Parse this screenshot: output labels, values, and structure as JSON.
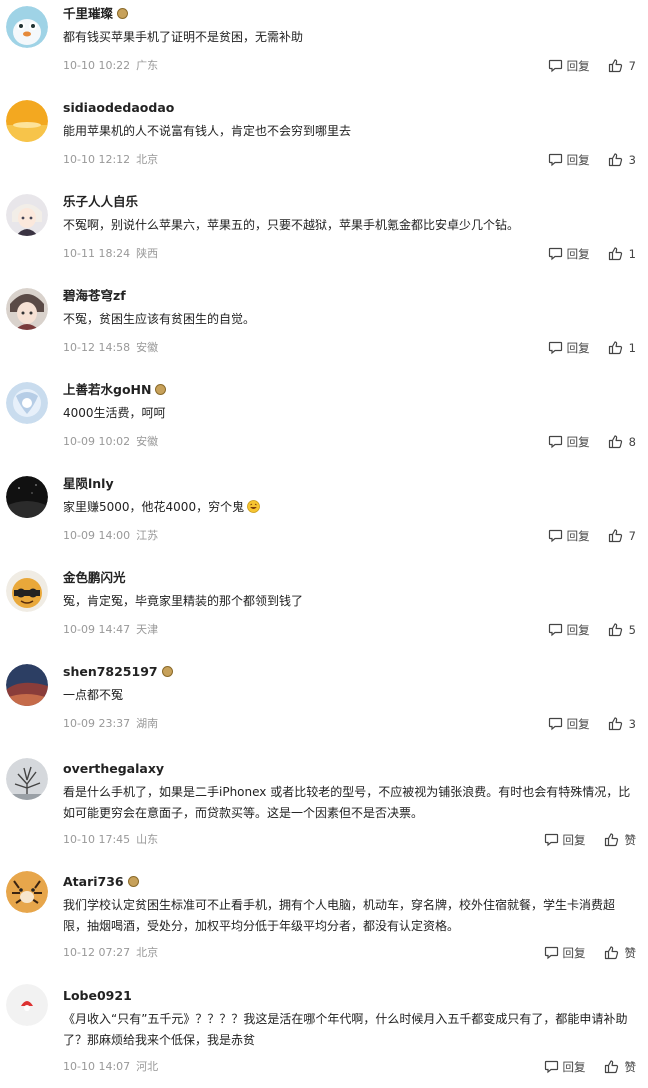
{
  "reply_label": "回复",
  "comments": [
    {
      "user": "千里璀璨",
      "badge": true,
      "text": "都有钱买苹果手机了证明不是贫困，无需补助",
      "time": "10-10 10:22",
      "location": "广东",
      "likes": "7"
    },
    {
      "user": "sidiaodedaodao",
      "badge": false,
      "text": "能用苹果机的人不说富有钱人，肯定也不会穷到哪里去",
      "time": "10-10 12:12",
      "location": "北京",
      "likes": "3"
    },
    {
      "user": "乐子人人自乐",
      "badge": false,
      "text": "不冤啊，别说什么苹果六，苹果五的，只要不越狱，苹果手机氪金都比安卓少几个钻。",
      "time": "10-11 18:24",
      "location": "陕西",
      "likes": "1"
    },
    {
      "user": "碧海苍穹zf",
      "badge": false,
      "text": "不冤，贫困生应该有贫困生的自觉。",
      "time": "10-12 14:58",
      "location": "安徽",
      "likes": "1"
    },
    {
      "user": "上善若水goHN",
      "badge": true,
      "text": "4000生活费，呵呵",
      "time": "10-09 10:02",
      "location": "安徽",
      "likes": "8"
    },
    {
      "user": "星陨lnly",
      "badge": false,
      "text": "家里赚5000，他花4000，穷个鬼",
      "emoji": true,
      "time": "10-09 14:00",
      "location": "江苏",
      "likes": "7"
    },
    {
      "user": "金色鹏闪光",
      "badge": false,
      "text": "冤，肯定冤，毕竟家里精装的那个都领到钱了",
      "time": "10-09 14:47",
      "location": "天津",
      "likes": "5"
    },
    {
      "user": "shen7825197",
      "badge": true,
      "text": "一点都不冤",
      "time": "10-09 23:37",
      "location": "湖南",
      "likes": "3"
    },
    {
      "user": "overthegalaxy",
      "badge": false,
      "text": "看是什么手机了，如果是二手iPhonex 或者比较老的型号，不应被视为铺张浪费。有时也会有特殊情况，比如可能更穷会在意面子，而贷款买等。这是一个因素但不是否决票。",
      "time": "10-10 17:45",
      "location": "山东",
      "likes": "赞"
    },
    {
      "user": "Atari736",
      "badge": true,
      "text": "我们学校认定贫困生标准可不止看手机，拥有个人电脑，机动车，穿名牌，校外住宿就餐，学生卡消费超限，抽烟喝酒，受处分，加权平均分低于年级平均分者，都没有认定资格。",
      "time": "10-12 07:27",
      "location": "北京",
      "likes": "赞"
    },
    {
      "user": "Lobe0921",
      "badge": false,
      "text": "《月收入“只有”五千元》？？？？我这是活在哪个年代啊，什么时候月入五千都变成只有了，都能申请补助了？那麻烦给我来个低保，我是赤贫",
      "time": "10-10 14:07",
      "location": "河北",
      "likes": "赞"
    }
  ]
}
